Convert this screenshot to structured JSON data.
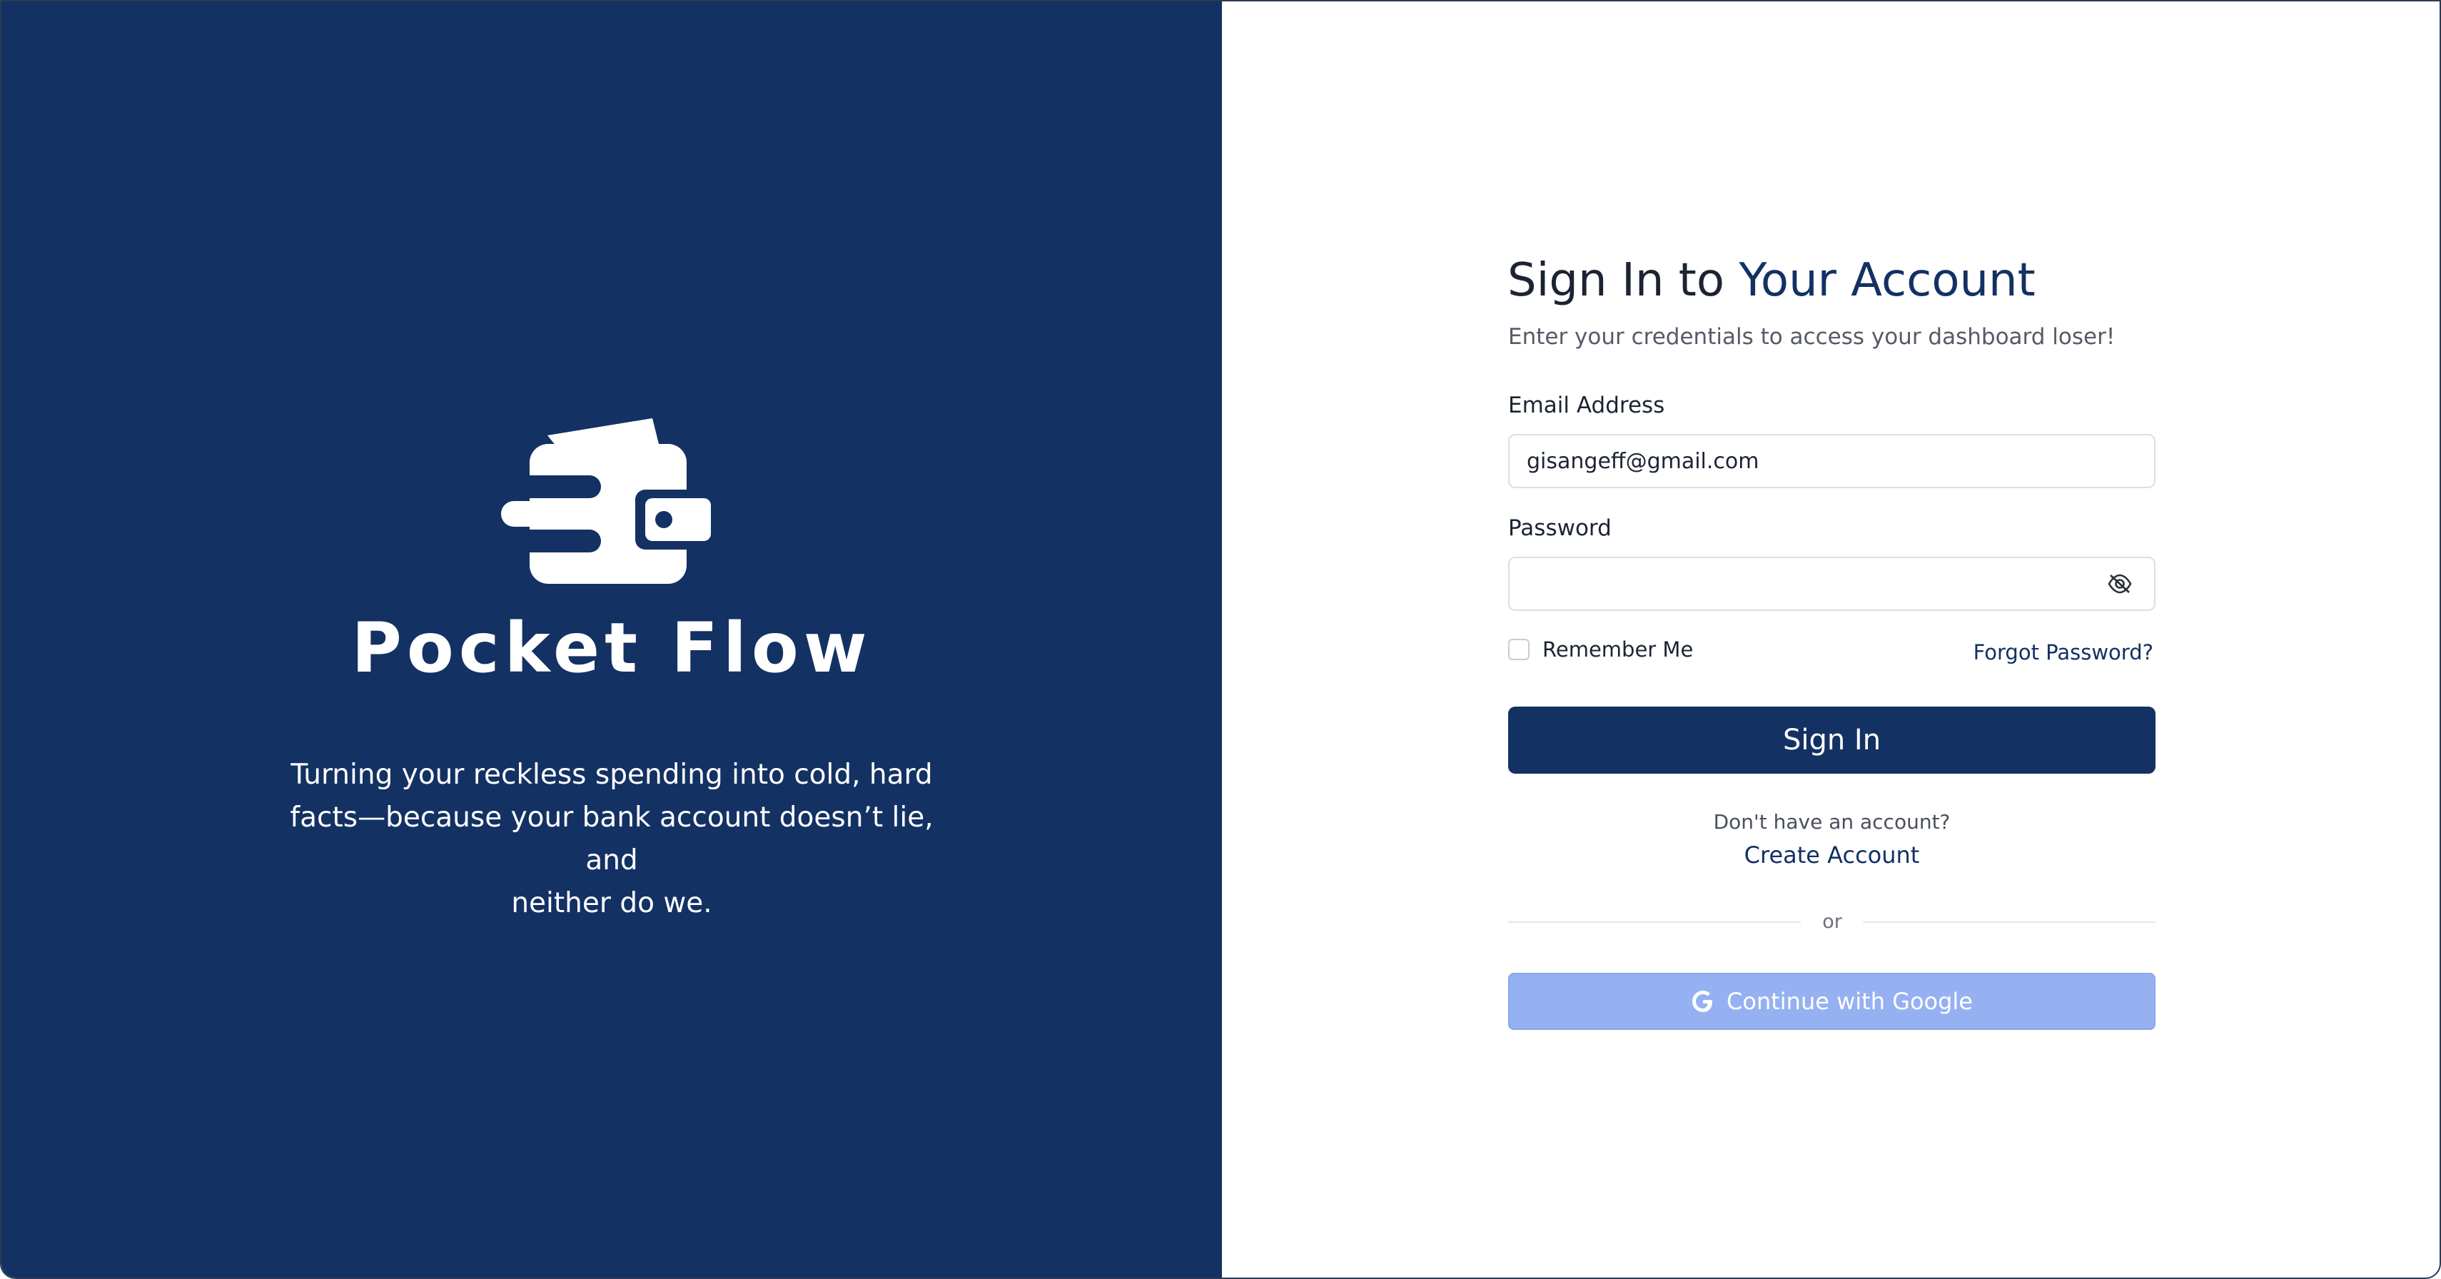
{
  "brand": {
    "name": "Pocket Flow",
    "tagline_lines": [
      "Turning your reckless spending into cold, hard",
      "facts—because your bank account doesn’t lie, and",
      "neither do we."
    ],
    "logo_icon": "wallet-speed-icon"
  },
  "form": {
    "title_prefix": "Sign In to ",
    "title_accent": "Your Account",
    "subtitle": "Enter your credentials to access your dashboard loser!",
    "email_label": "Email Address",
    "email_value": "gisangeff@gmail.com",
    "password_label": "Password",
    "password_value": "",
    "password_toggle_icon": "eye-slash-icon",
    "remember_label": "Remember Me",
    "remember_checked": false,
    "forgot_link": "Forgot Password?",
    "sign_in_button": "Sign In",
    "no_account_text": "Don't have an account?",
    "create_account_link": "Create Account",
    "divider_text": "or",
    "google_button": "Continue with Google",
    "google_icon": "google-g-icon"
  },
  "colors": {
    "brand_navy": "#133163",
    "google_button": "#96b1f1",
    "text_dark": "#1c2433",
    "text_muted": "#555b66"
  }
}
